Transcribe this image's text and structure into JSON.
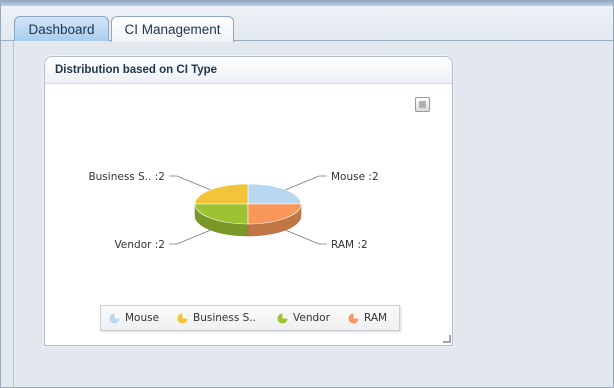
{
  "tabs": [
    {
      "label": "Dashboard",
      "active": true
    },
    {
      "label": "CI Management",
      "active": false
    }
  ],
  "panel": {
    "title": "Distribution based on CI Type",
    "menu_icon": "chart-menu-icon",
    "resize_icon": "resize-grip-icon"
  },
  "chart_data": {
    "type": "pie",
    "categories": [
      "Mouse",
      "Business S..",
      "Vendor",
      "RAM"
    ],
    "values": [
      2,
      2,
      2,
      2
    ],
    "labels": [
      "Mouse :2",
      "Business S.. :2",
      "Vendor :2",
      "RAM :2"
    ],
    "colors": [
      "#b7d6f0",
      "#f2c43a",
      "#9dc332",
      "#f7975a"
    ],
    "legend": "bottom"
  }
}
